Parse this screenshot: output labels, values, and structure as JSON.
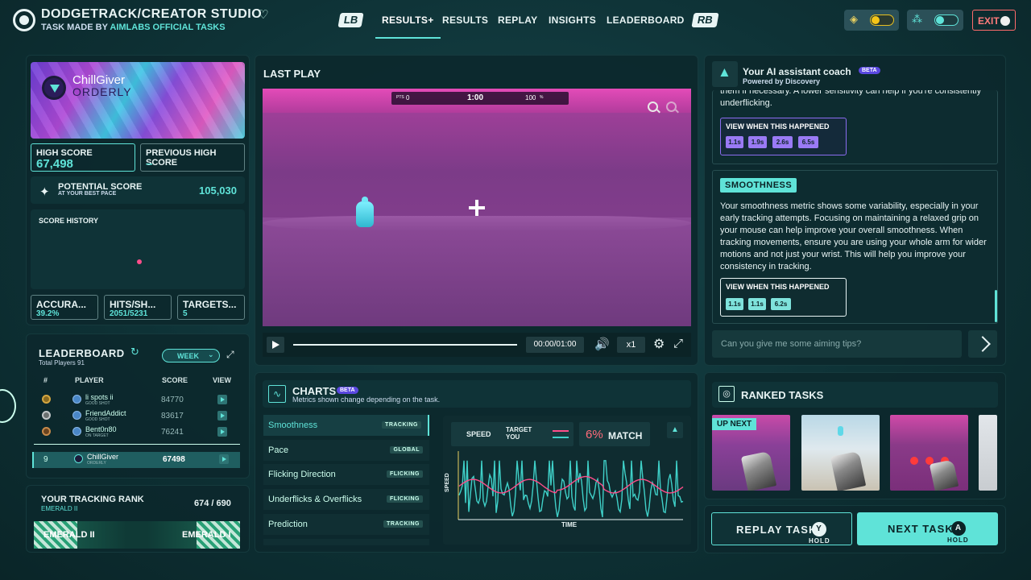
{
  "header": {
    "task_title": "DODGETRACK/CREATOR STUDIO",
    "task_made_by_prefix": "TASK MADE BY",
    "task_author": "AIMLABS OFFICIAL TASKS",
    "lb_button": "LB",
    "rb_button": "RB",
    "tabs": [
      {
        "label": "RESULTS+",
        "active": true
      },
      {
        "label": "RESULTS",
        "active": false
      },
      {
        "label": "REPLAY",
        "active": false
      },
      {
        "label": "INSIGHTS",
        "active": false
      },
      {
        "label": "LEADERBOARD",
        "active": false
      }
    ],
    "exit_label": "EXIT"
  },
  "profile": {
    "player_name": "ChillGiver",
    "team": "ORDERLY",
    "high_score_label": "HIGH SCORE",
    "high_score": "67,498",
    "previous_high_score_label": "PREVIOUS HIGH SCORE",
    "previous_high_score": "–",
    "potential_label": "POTENTIAL SCORE",
    "potential_sub": "AT YOUR BEST PACE",
    "potential_score": "105,030",
    "score_history_label": "SCORE HISTORY",
    "stats": [
      {
        "label": "ACCURA...",
        "value": "39.2%"
      },
      {
        "label": "HITS/SH...",
        "value": "2051/5231"
      },
      {
        "label": "TARGETS...",
        "value": "5"
      }
    ]
  },
  "leaderboard": {
    "title": "LEADERBOARD",
    "subtitle": "Total Players 91",
    "period": "WEEK",
    "columns": {
      "rank": "#",
      "player": "PLAYER",
      "score": "SCORE",
      "view": "VIEW"
    },
    "rows": [
      {
        "name": "li spots ii",
        "tag": "GOOD SHOT",
        "score": "84770",
        "medal": "#d4a641"
      },
      {
        "name": "FriendAddict",
        "tag": "GOOD SHOT",
        "score": "83617",
        "medal": "#c0c6c8"
      },
      {
        "name": "Bent0n80",
        "tag": "ON TARGET",
        "score": "76241",
        "medal": "#c88a4a"
      }
    ],
    "self": {
      "rank": "9",
      "name": "ChillGiver",
      "tag": "ORDERLY",
      "score": "67498"
    }
  },
  "tracking_rank": {
    "title": "YOUR TRACKING RANK",
    "current": "EMERALD II",
    "position": "674 / 690",
    "left_rank": "EMERALD II",
    "right_rank": "EMERALD I"
  },
  "last_play": {
    "title": "LAST PLAY",
    "hud": {
      "pts_label": "PTS",
      "pts": "0",
      "timer": "1:00",
      "accuracy": "100",
      "accuracy_unit": "%"
    },
    "time_display": "00:00/01:00",
    "speed": "x1"
  },
  "coach": {
    "title": "Your AI assistant coach",
    "beta": "BETA",
    "powered_by": "Powered by Discovery",
    "card1_text": "them if necessary. A lower sensitivity can help if you're consistently underflicking.",
    "view_when_label": "VIEW WHEN THIS HAPPENED",
    "card1_chips": [
      "1.1s",
      "1.9s",
      "2.6s",
      "6.5s"
    ],
    "card2_title": "SMOOTHNESS",
    "card2_text": "Your smoothness metric shows some variability, especially in your early tracking attempts. Focusing on maintaining a relaxed grip on your mouse can help improve your overall smoothness. When tracking movements, ensure you are using your whole arm for wider motions and not just your wrist. This will help you improve your consistency in tracking.",
    "card2_chips": [
      "1.1s",
      "1.1s",
      "6.2s"
    ],
    "input_placeholder": "Can you give me some aiming tips?"
  },
  "charts": {
    "title": "CHARTS",
    "beta": "BETA",
    "subtitle": "Metrics shown change depending on the task.",
    "metrics": [
      {
        "label": "Smoothness",
        "tag": "TRACKING",
        "active": true
      },
      {
        "label": "Pace",
        "tag": "GLOBAL",
        "active": false
      },
      {
        "label": "Flicking Direction",
        "tag": "FLICKING",
        "active": false
      },
      {
        "label": "Underflicks & Overflicks",
        "tag": "FLICKING",
        "active": false
      },
      {
        "label": "Prediction",
        "tag": "TRACKING",
        "active": false
      }
    ],
    "legend_speed": "SPEED",
    "legend_target": "TARGET",
    "legend_you": "YOU",
    "match_value": "6%",
    "match_label": "MATCH",
    "y_axis": "SPEED",
    "x_axis": "TIME",
    "colors": {
      "target": "#ff4d8a",
      "you": "#3fd0c8"
    }
  },
  "ranked_tasks": {
    "title": "RANKED TASKS",
    "up_next": "UP NEXT"
  },
  "actions": {
    "replay_label": "REPLAY TASK",
    "replay_key": "Y",
    "next_label": "NEXT TASK",
    "next_key": "A",
    "hold": "HOLD"
  }
}
